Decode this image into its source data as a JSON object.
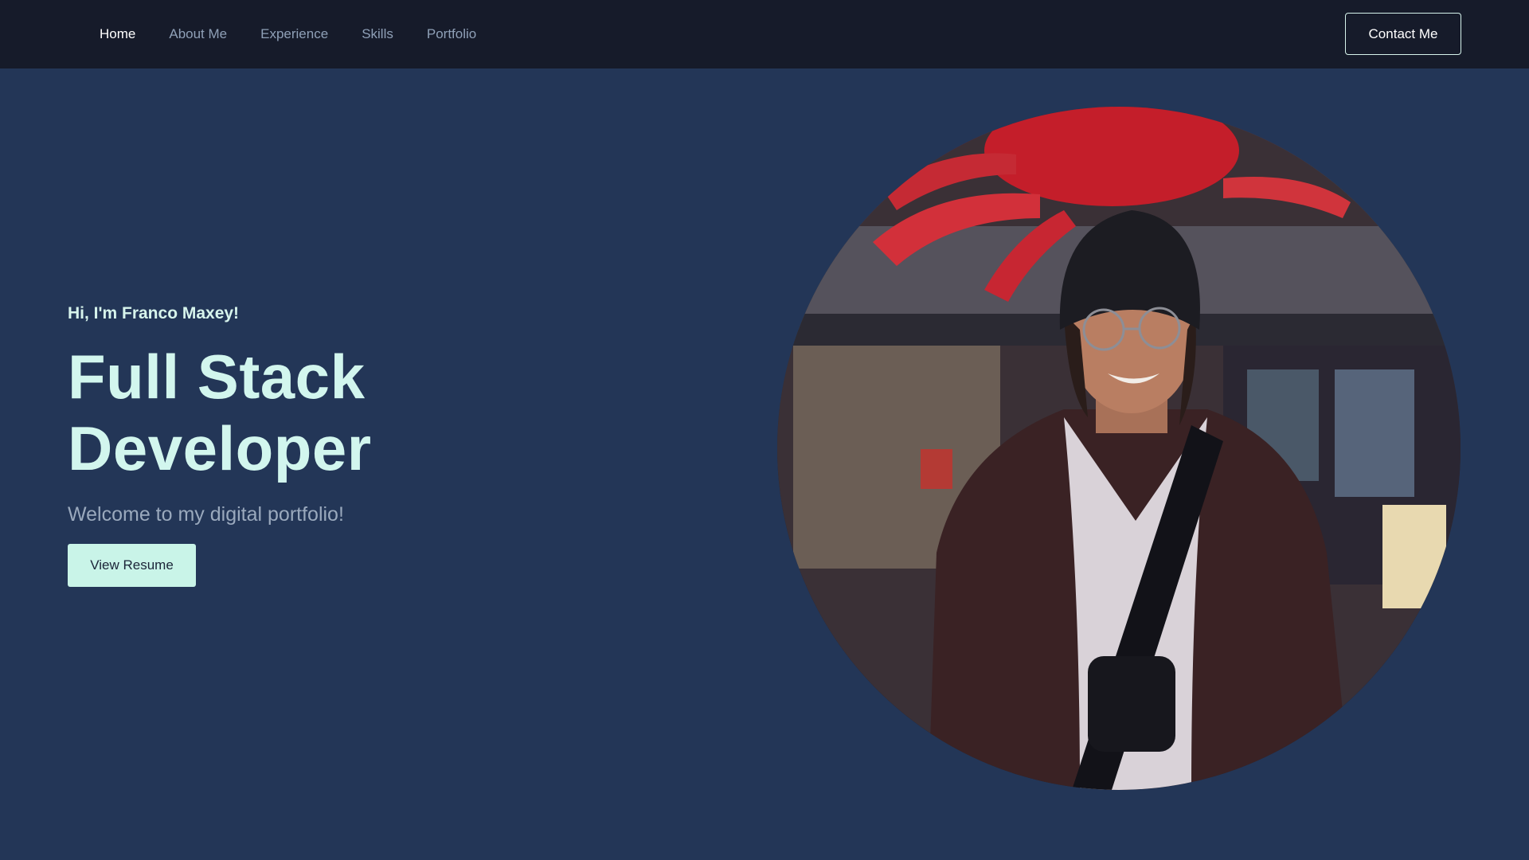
{
  "nav": {
    "items": [
      {
        "label": "Home",
        "active": true
      },
      {
        "label": "About Me",
        "active": false
      },
      {
        "label": "Experience",
        "active": false
      },
      {
        "label": "Skills",
        "active": false
      },
      {
        "label": "Portfolio",
        "active": false
      }
    ],
    "contact_label": "Contact Me"
  },
  "hero": {
    "greeting": "Hi, I'm Franco Maxey!",
    "title_line1": "Full Stack",
    "title_line2": "Developer",
    "subtitle": "Welcome to my digital portfolio!",
    "resume_label": "View Resume"
  },
  "colors": {
    "background": "#233657",
    "navbar": "#161b2a",
    "accent": "#d2f6ee"
  }
}
